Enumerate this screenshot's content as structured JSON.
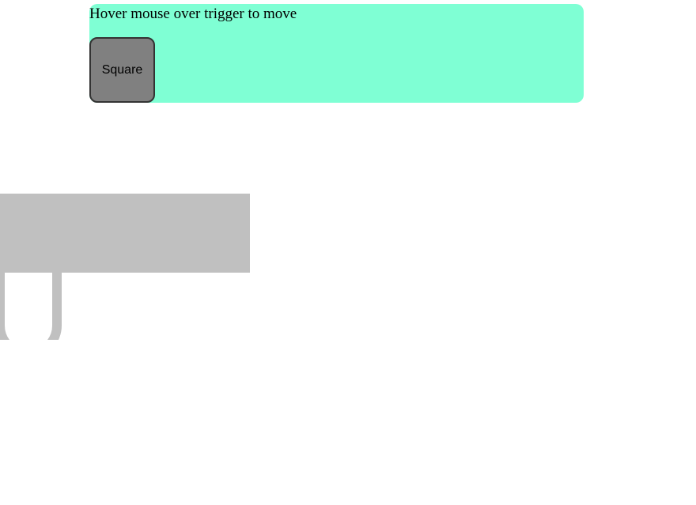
{
  "trigger_panel": {
    "instruction": "Hover mouse over trigger to move",
    "background_color": "#7fffd4"
  },
  "square": {
    "label": "Square",
    "fill_color": "#808080",
    "border_color": "#333333"
  },
  "decorations": {
    "shape_color": "#c0c0c0"
  }
}
